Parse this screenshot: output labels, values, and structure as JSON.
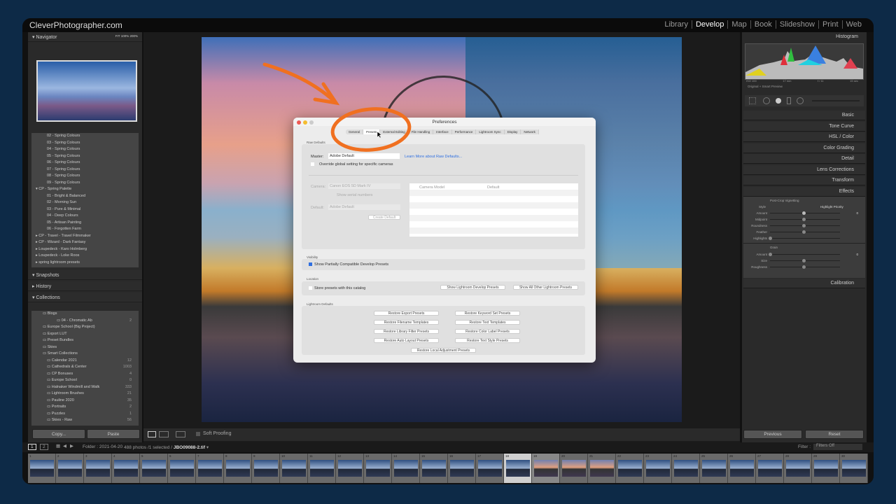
{
  "app": {
    "brand": "CleverPhotographer.com",
    "modules": [
      "Library",
      "Develop",
      "Map",
      "Book",
      "Slideshow",
      "Print",
      "Web"
    ],
    "active_module": "Develop"
  },
  "navigator": {
    "title": "Navigator",
    "zoom": [
      "FIT",
      "100%",
      "200%"
    ]
  },
  "presets": [
    "02 - Spring Colours",
    "03 - Spring Colours",
    "04 - Spring Colours",
    "05 - Spring Colours",
    "06 - Spring Colours",
    "07 - Spring Colours",
    "08 - Spring Colours",
    "09 - Spring Colours",
    "CP - Spring Palette",
    "01 - Bright & Balanced",
    "02 - Morning Sun",
    "03 - Pure & Minimal",
    "04 - Deep Colours",
    "05 - Artisan Painting",
    "06 - Forgotten Farm",
    "CP - Travel - Travel Filmmaker",
    "CP - Wizard - Dark Fantasy",
    "Loupedeck - Karo Holmberg",
    "Loupedeck - Loke Roos",
    "spring lightroom presets"
  ],
  "panels": {
    "snapshots": "Snapshots",
    "history": "History",
    "collections": "Collections"
  },
  "collections": [
    {
      "name": "Blogs",
      "count": ""
    },
    {
      "name": "04 - Chromatic Ab",
      "count": "2"
    },
    {
      "name": "Europe School (Big Project)",
      "count": ""
    },
    {
      "name": "Export LUT",
      "count": ""
    },
    {
      "name": "Preset Bundles",
      "count": ""
    },
    {
      "name": "Skies",
      "count": ""
    },
    {
      "name": "Smart Collections",
      "count": ""
    },
    {
      "name": "Calendar 2021",
      "count": "12"
    },
    {
      "name": "Cathedrals & Center",
      "count": "1003"
    },
    {
      "name": "CP Bonuses",
      "count": "4"
    },
    {
      "name": "Europe School",
      "count": "0"
    },
    {
      "name": "Halnaker Windmill and Walk",
      "count": "333"
    },
    {
      "name": "Lightroom Brushes",
      "count": "21"
    },
    {
      "name": "Pauline 2020",
      "count": "35"
    },
    {
      "name": "Portraits",
      "count": "2"
    },
    {
      "name": "Puzzles",
      "count": "1"
    },
    {
      "name": "Skies - Raw",
      "count": "56"
    }
  ],
  "left_buttons": {
    "copy": "Copy...",
    "paste": "Paste"
  },
  "toolbar": {
    "soft_proofing": "Soft Proofing"
  },
  "right": {
    "histogram": "Histogram",
    "histo_info": [
      "ISO 100",
      "17 mm",
      "f / 11",
      "15 sec"
    ],
    "preview": "Original + Smart Preview",
    "sections": [
      "Basic",
      "Tone Curve",
      "HSL / Color",
      "Color Grading",
      "Detail",
      "Lens Corrections",
      "Transform",
      "Effects"
    ],
    "effects": {
      "vignetting": "Post-Crop Vignetting",
      "style_label": "Style",
      "style": "Highlight Priority",
      "amount_label": "Amount",
      "amount": "0",
      "sliders": [
        "Midpoint",
        "Roundness",
        "Feather",
        "Highlights"
      ],
      "grain": "Grain",
      "grain_sliders": [
        "Amount",
        "Size",
        "Roughness"
      ],
      "grain_amount": "0"
    },
    "calibration": "Calibration",
    "previous": "Previous",
    "reset": "Reset"
  },
  "filmstrip": {
    "folder": "Folder : 2021-04-20",
    "info": "488 photos /1 selected /",
    "file": "JBO09088-2.tif",
    "filter_label": "Filter :",
    "filter": "Filters Off",
    "selected": 18
  },
  "dialog": {
    "title": "Preferences",
    "tabs": [
      "General",
      "Presets",
      "External Editing",
      "File Handling",
      "Interface",
      "Performance",
      "Lightroom Sync",
      "Display",
      "Network"
    ],
    "active_tab": "Presets",
    "raw_defaults": "Raw Defaults",
    "master_label": "Master:",
    "master": "Adobe Default",
    "learn_more": "Learn More about Raw Defaults...",
    "override": "Override global setting for specific cameras",
    "camera_label": "Camera:",
    "camera": "Canon EOS 5D Mark IV",
    "show_serial": "Show serial numbers",
    "default_label": "Default:",
    "default": "Adobe Default",
    "create_default": "Create Default",
    "col_camera": "Camera Model",
    "col_default": "Default",
    "visibility": "Visibility",
    "show_partial": "Show Partially Compatible Develop Presets",
    "location": "Location",
    "store": "Store presets with this catalog",
    "show_develop": "Show Lightroom Develop Presets",
    "show_other": "Show All Other Lightroom Presets",
    "lr_defaults": "Lightroom Defaults",
    "restore": [
      "Restore Export Presets",
      "Restore Keyword Set Presets",
      "Restore Filename Templates",
      "Restore Text Templates",
      "Restore Library Filter Presets",
      "Restore Color Label Presets",
      "Restore Auto Layout Presets",
      "Restore Text Style Presets"
    ],
    "restore_local": "Restore Local Adjustment Presets"
  },
  "colors": {
    "background": "#0d2a47",
    "annotation": "#f07020",
    "accent": "#2f6fe0"
  }
}
